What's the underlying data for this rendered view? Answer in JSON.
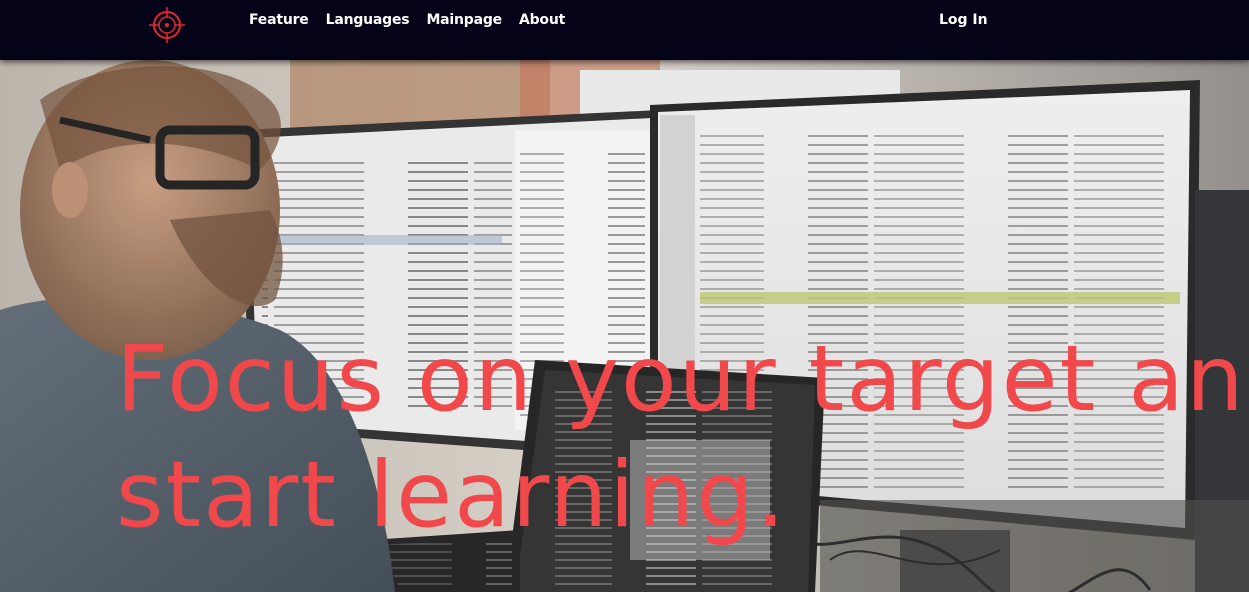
{
  "navbar": {
    "logo_icon": "crosshair-target-icon",
    "links": [
      "Feature",
      "Languages",
      "Mainpage",
      "About"
    ],
    "login_label": "Log In"
  },
  "hero": {
    "headline_line1": "Focus on your target and",
    "headline_line2": "start learning.",
    "background_image": "developer-at-computer-photo"
  },
  "colors": {
    "navbar_bg": "#050318",
    "headline": "#f1484c",
    "logo": "#e0282e"
  }
}
